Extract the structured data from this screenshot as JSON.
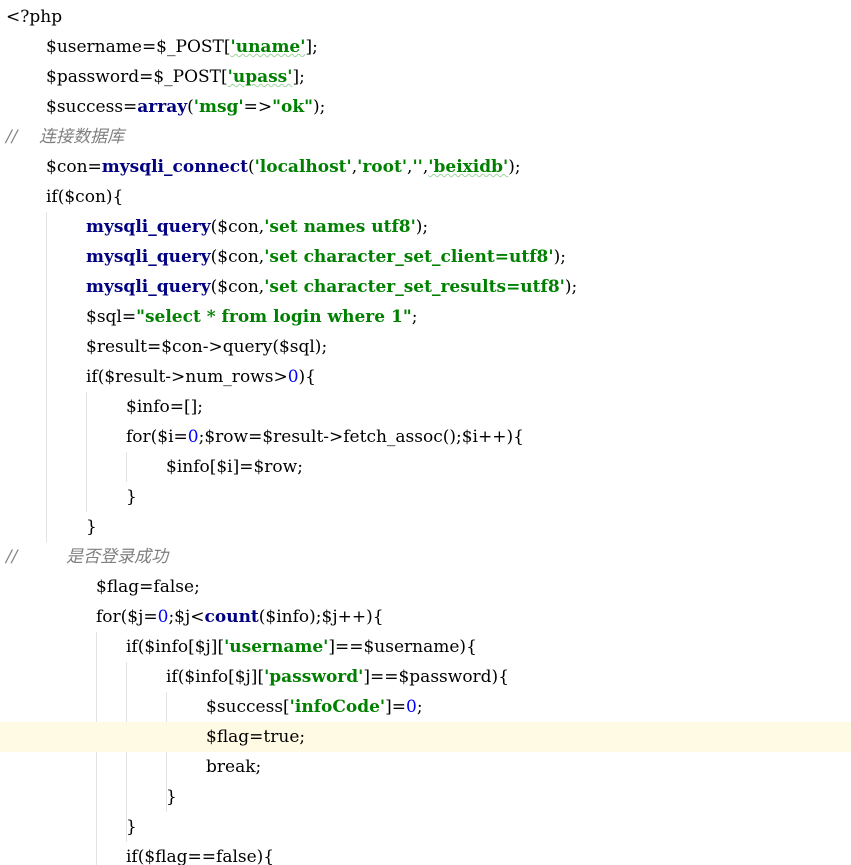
{
  "editor": {
    "current_line_color": "#fffae3",
    "lines": [
      {
        "indent": 0,
        "tokens": [
          {
            "t": "<?php",
            "k": "txt"
          }
        ]
      },
      {
        "indent": 1,
        "tokens": [
          {
            "t": "$username=$_POST[",
            "k": "txt"
          },
          {
            "t": "'uname'",
            "k": "str",
            "typo": true
          },
          {
            "t": "];",
            "k": "txt"
          }
        ]
      },
      {
        "indent": 1,
        "tokens": [
          {
            "t": "$password=$_POST[",
            "k": "txt"
          },
          {
            "t": "'upass'",
            "k": "str",
            "typo": true
          },
          {
            "t": "];",
            "k": "txt"
          }
        ]
      },
      {
        "indent": 1,
        "tokens": [
          {
            "t": "$success=",
            "k": "txt"
          },
          {
            "t": "array",
            "k": "kw"
          },
          {
            "t": "(",
            "k": "txt"
          },
          {
            "t": "'msg'",
            "k": "str"
          },
          {
            "t": "=>",
            "k": "txt"
          },
          {
            "t": "\"ok\"",
            "k": "str"
          },
          {
            "t": ");",
            "k": "txt"
          }
        ]
      },
      {
        "indent": 0,
        "tokens": [
          {
            "t": "//    连接数据库",
            "k": "cmt"
          }
        ]
      },
      {
        "indent": 1,
        "tokens": [
          {
            "t": "$con=",
            "k": "txt"
          },
          {
            "t": "mysqli_connect",
            "k": "fn"
          },
          {
            "t": "(",
            "k": "txt"
          },
          {
            "t": "'localhost'",
            "k": "str"
          },
          {
            "t": ",",
            "k": "txt"
          },
          {
            "t": "'root'",
            "k": "str"
          },
          {
            "t": ",",
            "k": "txt"
          },
          {
            "t": "''",
            "k": "str"
          },
          {
            "t": ",",
            "k": "txt"
          },
          {
            "t": "'beixidb'",
            "k": "str",
            "typo": true
          },
          {
            "t": ");",
            "k": "txt"
          }
        ]
      },
      {
        "indent": 1,
        "tokens": [
          {
            "t": "if",
            "k": "txt"
          },
          {
            "t": "($con){",
            "k": "txt"
          }
        ]
      },
      {
        "indent": 2,
        "tokens": [
          {
            "t": "mysqli_query",
            "k": "fn"
          },
          {
            "t": "($con,",
            "k": "txt"
          },
          {
            "t": "'set names utf8'",
            "k": "str"
          },
          {
            "t": ");",
            "k": "txt"
          }
        ]
      },
      {
        "indent": 2,
        "tokens": [
          {
            "t": "mysqli_query",
            "k": "fn"
          },
          {
            "t": "($con,",
            "k": "txt"
          },
          {
            "t": "'set character_set_client=utf8'",
            "k": "str"
          },
          {
            "t": ");",
            "k": "txt"
          }
        ]
      },
      {
        "indent": 2,
        "tokens": [
          {
            "t": "mysqli_query",
            "k": "fn"
          },
          {
            "t": "($con,",
            "k": "txt"
          },
          {
            "t": "'set character_set_results=utf8'",
            "k": "str"
          },
          {
            "t": ");",
            "k": "txt"
          }
        ]
      },
      {
        "indent": 2,
        "tokens": [
          {
            "t": "$sql=",
            "k": "txt"
          },
          {
            "t": "\"select * from login where 1\"",
            "k": "str"
          },
          {
            "t": ";",
            "k": "txt"
          }
        ]
      },
      {
        "indent": 2,
        "tokens": [
          {
            "t": "$result=$con->query($sql);",
            "k": "txt"
          }
        ]
      },
      {
        "indent": 2,
        "tokens": [
          {
            "t": "if($result->num_rows>",
            "k": "txt"
          },
          {
            "t": "0",
            "k": "num"
          },
          {
            "t": "){",
            "k": "txt"
          }
        ]
      },
      {
        "indent": 3,
        "tokens": [
          {
            "t": "$info=[];",
            "k": "txt"
          }
        ]
      },
      {
        "indent": 3,
        "tokens": [
          {
            "t": "for($i=",
            "k": "txt"
          },
          {
            "t": "0",
            "k": "num"
          },
          {
            "t": ";$row=$result->fetch_assoc();$i++){",
            "k": "txt"
          }
        ]
      },
      {
        "indent": 4,
        "tokens": [
          {
            "t": "$info[$i]=$row;",
            "k": "txt"
          }
        ]
      },
      {
        "indent": 3,
        "tokens": [
          {
            "t": "}",
            "k": "txt"
          }
        ]
      },
      {
        "indent": 2,
        "tokens": [
          {
            "t": "}",
            "k": "txt"
          }
        ]
      },
      {
        "indent": 0,
        "tokens": [
          {
            "t": "//         是否登录成功",
            "k": "cmt"
          }
        ]
      },
      {
        "indent": 2.25,
        "tokens": [
          {
            "t": "$flag=false;",
            "k": "txt"
          }
        ]
      },
      {
        "indent": 2.25,
        "tokens": [
          {
            "t": "for($j=",
            "k": "txt"
          },
          {
            "t": "0",
            "k": "num"
          },
          {
            "t": ";$j<",
            "k": "txt"
          },
          {
            "t": "count",
            "k": "fn"
          },
          {
            "t": "($info);$j++){",
            "k": "txt"
          }
        ]
      },
      {
        "indent": 3,
        "tokens": [
          {
            "t": "if($info[$j][",
            "k": "txt"
          },
          {
            "t": "'username'",
            "k": "str"
          },
          {
            "t": "]==$username){",
            "k": "txt"
          }
        ]
      },
      {
        "indent": 4,
        "tokens": [
          {
            "t": "if($info[$j][",
            "k": "txt"
          },
          {
            "t": "'password'",
            "k": "str"
          },
          {
            "t": "]==$password){",
            "k": "txt"
          }
        ]
      },
      {
        "indent": 5,
        "tokens": [
          {
            "t": "$success[",
            "k": "txt"
          },
          {
            "t": "'infoCode'",
            "k": "str"
          },
          {
            "t": "]=",
            "k": "txt"
          },
          {
            "t": "0",
            "k": "num"
          },
          {
            "t": ";",
            "k": "txt"
          }
        ]
      },
      {
        "indent": 5,
        "current": true,
        "tokens": [
          {
            "t": "$flag=true;",
            "k": "txt"
          }
        ]
      },
      {
        "indent": 5,
        "tokens": [
          {
            "t": "break;",
            "k": "txt"
          }
        ]
      },
      {
        "indent": 4,
        "tokens": [
          {
            "t": "}",
            "k": "txt"
          }
        ]
      },
      {
        "indent": 3,
        "tokens": [
          {
            "t": "}",
            "k": "txt"
          }
        ]
      },
      {
        "indent": 3,
        "tokens": [
          {
            "t": "if($flag==false){",
            "k": "txt"
          }
        ]
      }
    ]
  }
}
